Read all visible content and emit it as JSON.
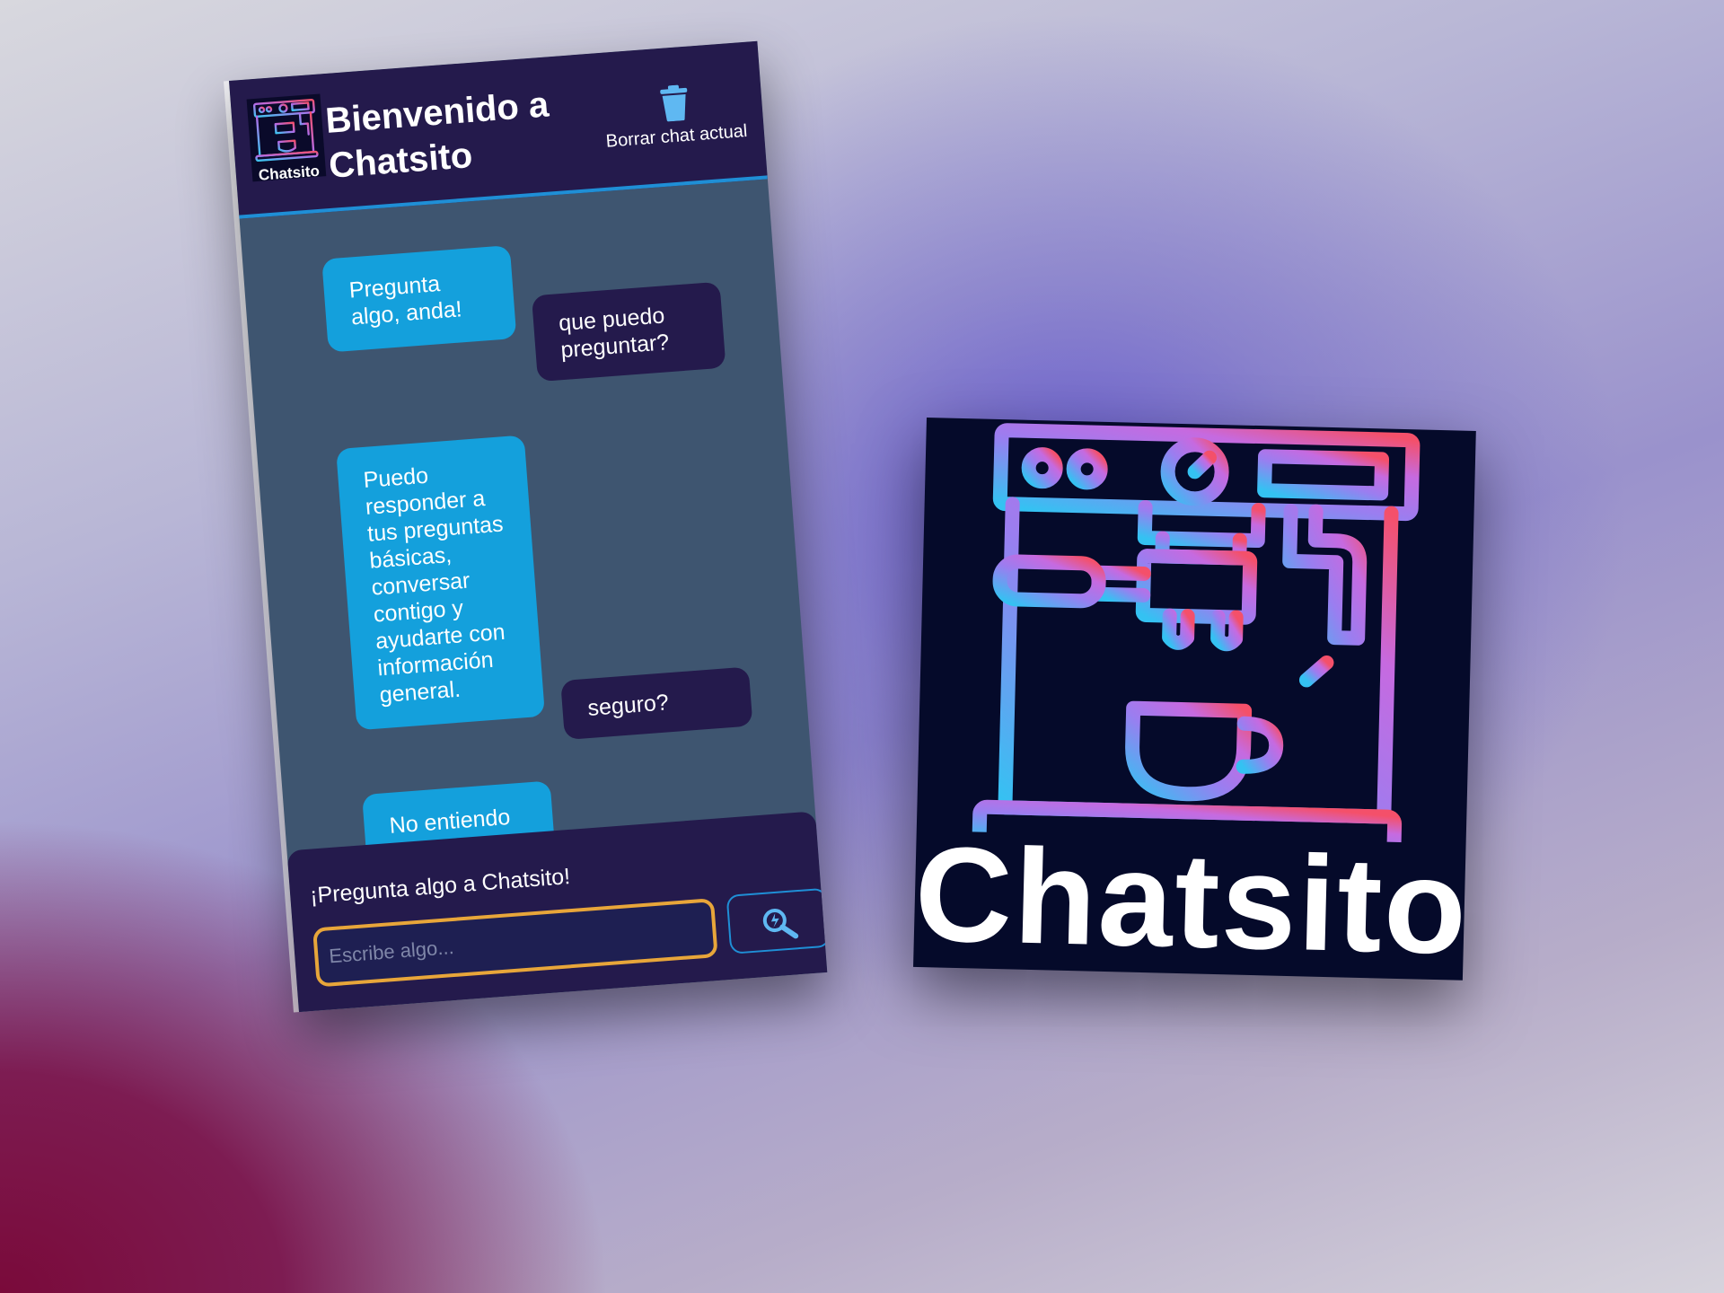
{
  "header": {
    "logo_text": "Chatsito",
    "title": "Bienvenido a Chatsito",
    "clear_chat_label": "Borrar chat actual"
  },
  "messages": [
    {
      "role": "bot",
      "text": "Pregunta algo, anda!"
    },
    {
      "role": "user",
      "text": "que puedo preguntar?"
    },
    {
      "role": "bot",
      "text": "Puedo responder a tus preguntas básicas, conversar contigo y ayudarte con información general."
    },
    {
      "role": "user",
      "text": "seguro?"
    },
    {
      "role": "bot",
      "text": "No entiendo tu pregunta. ¿Puedes reformularla?"
    }
  ],
  "composer": {
    "label": "¡Pregunta algo a Chatsito!",
    "placeholder": "Escribe algo...",
    "value": ""
  },
  "logo_card": {
    "wordmark": "Chatsito"
  },
  "icons": {
    "clear": "trash-icon",
    "send": "search-spark-icon",
    "logo": "coffee-machine-icon"
  },
  "colors": {
    "header_bg": "#241a4c",
    "chat_bg": "#3e5570",
    "bot_bubble": "#14a0dc",
    "user_bubble": "#241a4c",
    "accent_blue": "#1f8fd6",
    "input_border": "#e8a63a"
  }
}
